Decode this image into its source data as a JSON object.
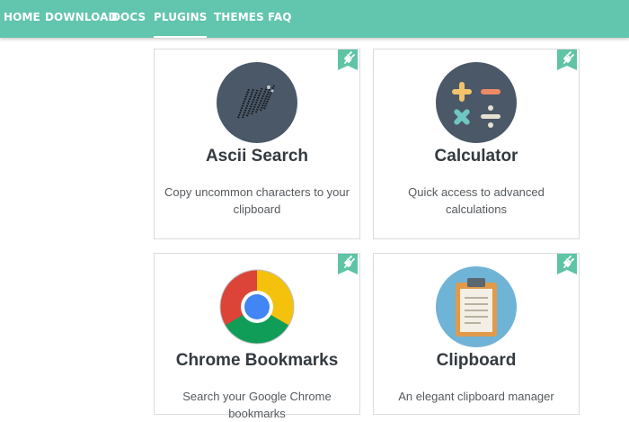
{
  "nav": {
    "items": [
      {
        "label": "HOME"
      },
      {
        "label": "DOWNLOAD"
      },
      {
        "label": "DOCS"
      },
      {
        "label": "PLUGINS",
        "active": true
      },
      {
        "label": "THEMES"
      },
      {
        "label": "FAQ"
      }
    ]
  },
  "plugins": [
    {
      "title": "Ascii Search",
      "description": "Copy uncommon characters to your clipboard",
      "icon": "ascii-search-icon"
    },
    {
      "title": "Calculator",
      "description": "Quick access to advanced calculations",
      "icon": "calculator-icon"
    },
    {
      "title": "Chrome Bookmarks",
      "description": "Search your Google Chrome bookmarks",
      "icon": "chrome-icon"
    },
    {
      "title": "Clipboard",
      "description": "An elegant clipboard manager",
      "icon": "clipboard-icon"
    }
  ],
  "colors": {
    "nav_bg": "#62c5ad",
    "tag": "#5fc4a6",
    "icon_circle_dark": "#4a5868",
    "icon_circle_light": "#6fb3d6"
  }
}
